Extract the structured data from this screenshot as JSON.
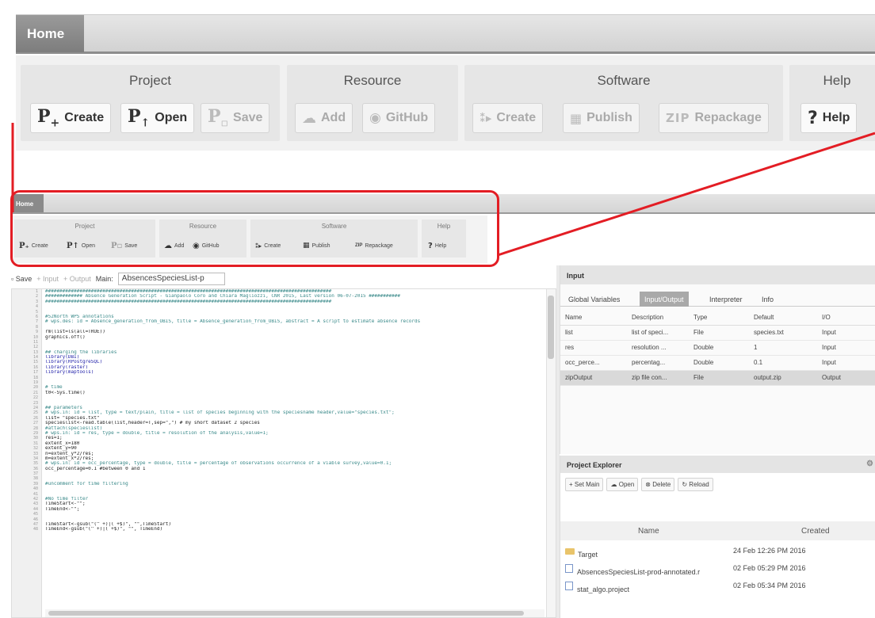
{
  "zoom": {
    "home_tab": "Home",
    "groups": [
      {
        "title": "Project",
        "buttons": [
          "Create",
          "Open",
          "Save"
        ]
      },
      {
        "title": "Resource",
        "buttons": [
          "Add",
          "GitHub"
        ]
      },
      {
        "title": "Software",
        "buttons": [
          "Create",
          "Publish",
          "Repackage"
        ]
      },
      {
        "title": "Help",
        "buttons": [
          "Help"
        ]
      }
    ],
    "zip_label": "ZIP"
  },
  "app": {
    "home_tab": "Home",
    "groups": [
      {
        "title": "Project",
        "buttons": [
          "Create",
          "Open",
          "Save"
        ]
      },
      {
        "title": "Resource",
        "buttons": [
          "Add",
          "GitHub"
        ]
      },
      {
        "title": "Software",
        "buttons": [
          "Create",
          "Publish",
          "Repackage"
        ]
      },
      {
        "title": "Help",
        "buttons": [
          "Help"
        ]
      }
    ],
    "zip_label": "ZIP"
  },
  "editor_toolbar": {
    "save": "Save",
    "input": "+ Input",
    "output": "+ Output",
    "main_label": "Main:",
    "main_value": "AbsencesSpeciesList-p"
  },
  "code_lines": [
    "####################################################################################################",
    "############# Absence Generation Script - Gianpaolo Coro and Chiara Magliozzi, CNR 2015, Last version 06-07-2015 ###########",
    "####################################################################################################",
    "",
    "",
    "#52North WPS annotations",
    "# wps.des: id = Absence_generation_from_OBIS, title = Absence_generation_from_OBIS, abstract = A script to estimate absence records",
    "",
    "rm(list=ls(all=TRUE))",
    "graphics.off()",
    "",
    "",
    "## charging the libraries",
    "library(DBI)",
    "library(RPostgreSQL)",
    "library(raster)",
    "library(maptools)",
    "",
    "",
    "# time",
    "t0<-Sys.time()",
    "",
    "",
    "## parameters",
    "# wps.in: id = list, type = text/plain, title = list of species beginning with the speciesname header,value=\"species.txt\";",
    "list= \"species.txt\"",
    "specieslist<-read.table(list,header=T,sep=\",\") # my short dataset 2 species",
    "#attach(specieslist)",
    "# wps.in: id = res, type = double, title = resolution of the analysis,value=1;",
    "res=1;",
    "extent_x=180",
    "extent_y=90",
    "n=extent_y*2/res;",
    "m=extent_x*2/res;",
    "# wps.in: id = occ_percentage, type = double, title = percentage of observations occurrence of a viable survey,value=0.1;",
    "occ_percentage=0.1 #between 0 and 1",
    "",
    "",
    "#uncomment for time filtering",
    "",
    "",
    "#No time filter",
    "TimeStart<-\"\";",
    "TimeEnd<-\"\";",
    "",
    "",
    "TimeStart<-gsub(\"(^ +)|( +$)\", \"\",TimeStart)",
    "TimeEnd<-gsub(\"(^ +)|( +$)\", \"\", TimeEnd)"
  ],
  "input_panel": {
    "title": "Input",
    "tabs": [
      "Global Variables",
      "Input/Output",
      "Interpreter",
      "Info"
    ],
    "columns": [
      "Name",
      "Description",
      "Type",
      "Default",
      "I/O"
    ],
    "rows": [
      [
        "list",
        "list of speci...",
        "File",
        "species.txt",
        "Input"
      ],
      [
        "res",
        "resolution ...",
        "Double",
        "1",
        "Input"
      ],
      [
        "occ_perce...",
        "percentag...",
        "Double",
        "0.1",
        "Input"
      ],
      [
        "zipOutput",
        "zip file con...",
        "File",
        "output.zip",
        "Output"
      ]
    ]
  },
  "explorer": {
    "title": "Project Explorer",
    "tools": [
      "Set Main",
      "Open",
      "Delete",
      "Reload"
    ],
    "columns": [
      "Name",
      "Created"
    ],
    "rows": [
      {
        "name": "Target",
        "created": "24 Feb 12:26 PM 2016",
        "kind": "folder"
      },
      {
        "name": "AbsencesSpeciesList-prod-annotated.r",
        "created": "02 Feb 05:29 PM 2016",
        "kind": "file"
      },
      {
        "name": "stat_algo.project",
        "created": "02 Feb 05:34 PM 2016",
        "kind": "file"
      }
    ]
  },
  "colors": {
    "callout": "#e31d24",
    "active_tab": "#a9a9a9"
  }
}
